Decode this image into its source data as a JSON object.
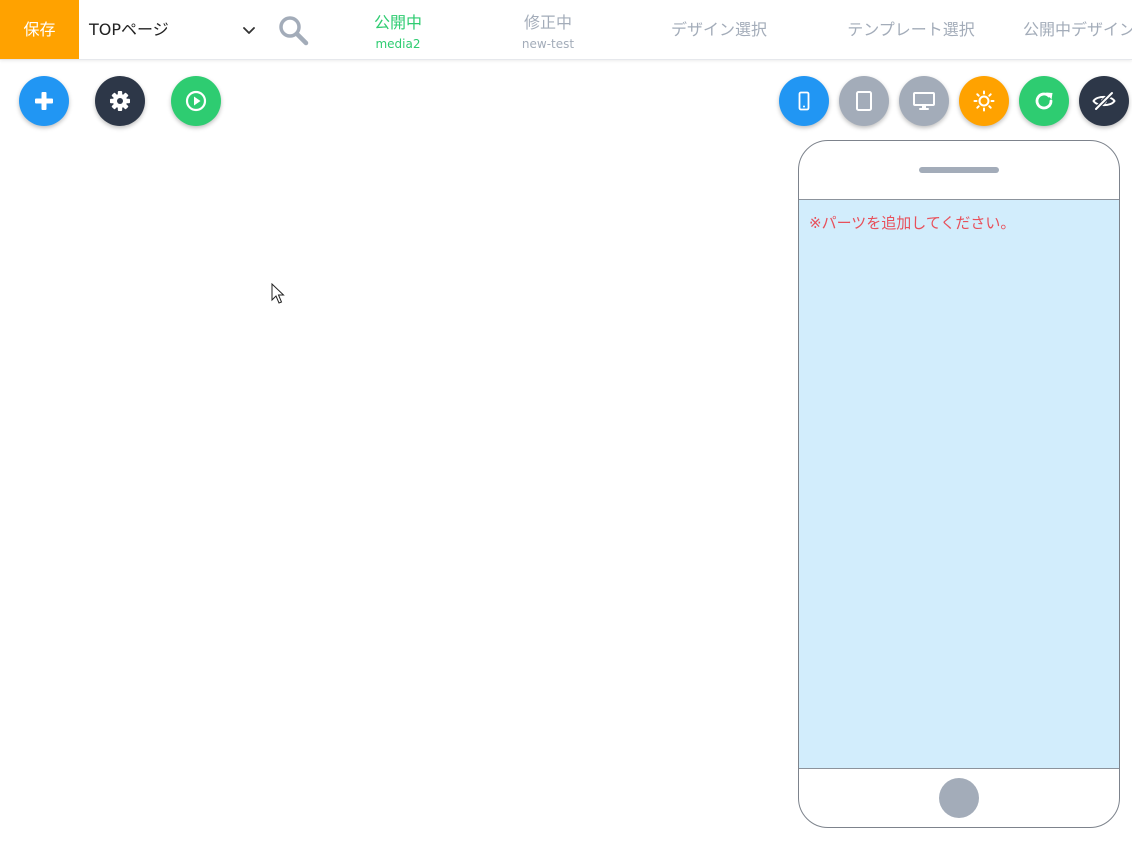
{
  "toolbar": {
    "save_label": "保存",
    "page_select": {
      "selected": "TOPページ"
    },
    "tabs": {
      "public": {
        "label": "公開中",
        "sub": "media2"
      },
      "editing": {
        "label": "修正中",
        "sub": "new-test"
      },
      "design_select": {
        "label": "デザイン選択"
      },
      "template_select": {
        "label": "テンプレート選択"
      },
      "public_design": {
        "label": "公開中デザイン"
      }
    }
  },
  "actions_left": [
    {
      "icon": "plus-icon",
      "color": "#2196f3"
    },
    {
      "icon": "gear-icon",
      "color": "#2d3748"
    },
    {
      "icon": "play-icon",
      "color": "#2ecc71"
    }
  ],
  "actions_right": [
    {
      "icon": "smartphone-icon",
      "color": "#2196f3"
    },
    {
      "icon": "tablet-icon",
      "color": "#a3acb9"
    },
    {
      "icon": "monitor-icon",
      "color": "#a3acb9"
    },
    {
      "icon": "sun-icon",
      "color": "#ffa200"
    },
    {
      "icon": "refresh-icon",
      "color": "#2ecc71"
    },
    {
      "icon": "eye-off-icon",
      "color": "#2d3748"
    }
  ],
  "preview": {
    "notice": "※パーツを追加してください。"
  },
  "colors": {
    "accent_orange": "#ffa200",
    "accent_blue": "#2196f3",
    "accent_green": "#2ecc71",
    "dark": "#2d3748",
    "muted": "#a3acb9",
    "screen_bg": "#d2edfc",
    "notice_red": "#e8505b"
  }
}
